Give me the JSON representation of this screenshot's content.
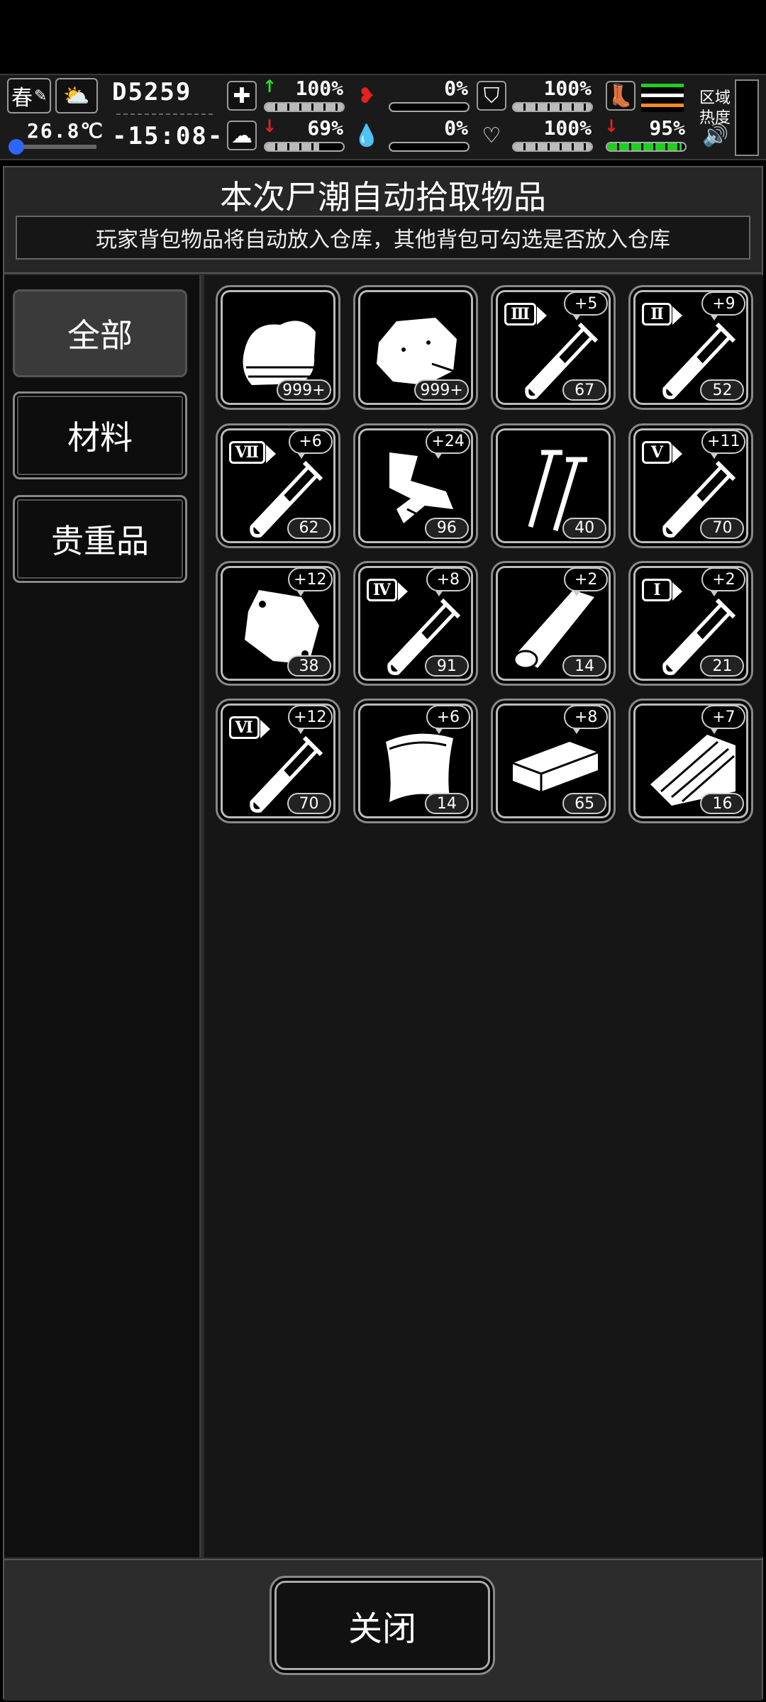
{
  "hud": {
    "season": "春",
    "temperature": "26.8℃",
    "day": "D5259",
    "time": "-15:08-",
    "health_pct": "100%",
    "stomach_pct": "0%",
    "armor_pct": "100%",
    "sanity_pct": "69%",
    "blood_pct": "0%",
    "heart_pct": "100%",
    "stamina_pct": "95%",
    "health_level": 1.0,
    "stomach_level": 0.0,
    "armor_level": 1.0,
    "sanity_level": 0.69,
    "blood_level": 0.0,
    "heart_level": 1.0,
    "stamina_level": 0.95,
    "region_heat_label_1": "区域",
    "region_heat_label_2": "热度",
    "icons": [
      "feather-icon",
      "weather-icon",
      "medkit-icon",
      "stomach-icon",
      "armor-icon",
      "brain-icon",
      "blood-drop-icon",
      "heart-icon",
      "boot-icon",
      "speaker-icon"
    ],
    "colors": {
      "up": "#27e027",
      "down": "#e52020",
      "stomach": "#e52020",
      "boot": "#1fd11f"
    }
  },
  "dialog": {
    "title": "本次尸潮自动拾取物品",
    "subtitle": "玩家背包物品将自动放入仓库，其他背包可勾选是否放入仓库"
  },
  "tabs": [
    {
      "label": "全部",
      "active": true
    },
    {
      "label": "材料",
      "active": false
    },
    {
      "label": "贵重品",
      "active": false
    }
  ],
  "items": [
    {
      "icon": "cloth-icon",
      "count": "999+",
      "plus": "",
      "roman": ""
    },
    {
      "icon": "stone-icon",
      "count": "999+",
      "plus": "",
      "roman": ""
    },
    {
      "icon": "test-tube-icon",
      "count": "67",
      "plus": "+5",
      "roman": "Ⅲ"
    },
    {
      "icon": "test-tube-icon",
      "count": "52",
      "plus": "+9",
      "roman": "Ⅱ"
    },
    {
      "icon": "test-tube-icon",
      "count": "62",
      "plus": "+6",
      "roman": "Ⅶ"
    },
    {
      "icon": "scrap-metal-icon",
      "count": "96",
      "plus": "+24",
      "roman": ""
    },
    {
      "icon": "nails-icon",
      "count": "40",
      "plus": "",
      "roman": ""
    },
    {
      "icon": "test-tube-icon",
      "count": "70",
      "plus": "+11",
      "roman": "Ⅴ"
    },
    {
      "icon": "bag-icon",
      "count": "38",
      "plus": "+12",
      "roman": ""
    },
    {
      "icon": "test-tube-icon",
      "count": "91",
      "plus": "+8",
      "roman": "Ⅳ"
    },
    {
      "icon": "log-icon",
      "count": "14",
      "plus": "+2",
      "roman": ""
    },
    {
      "icon": "test-tube-icon",
      "count": "21",
      "plus": "+2",
      "roman": "Ⅰ"
    },
    {
      "icon": "test-tube-icon",
      "count": "70",
      "plus": "+12",
      "roman": "Ⅵ"
    },
    {
      "icon": "leather-icon",
      "count": "14",
      "plus": "+6",
      "roman": ""
    },
    {
      "icon": "plank-icon",
      "count": "65",
      "plus": "+8",
      "roman": ""
    },
    {
      "icon": "wood-pile-icon",
      "count": "16",
      "plus": "+7",
      "roman": ""
    }
  ],
  "footer": {
    "close_label": "关闭"
  }
}
